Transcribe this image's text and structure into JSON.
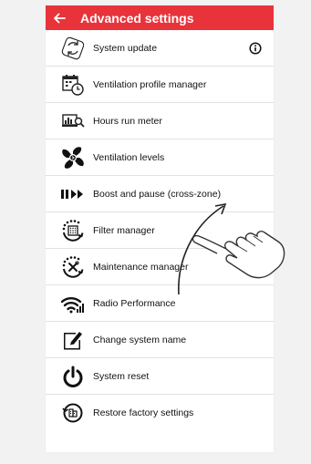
{
  "header": {
    "title": "Advanced settings"
  },
  "items": [
    {
      "label": "System update",
      "icon": "refresh-icon",
      "info_icon": "info-icon"
    },
    {
      "label": "Ventilation profile manager",
      "icon": "calendar-clock-icon"
    },
    {
      "label": "Hours run meter",
      "icon": "chart-magnifier-icon"
    },
    {
      "label": "Ventilation levels",
      "icon": "fan-icon"
    },
    {
      "label": "Boost and pause (cross-zone)",
      "icon": "pause-fast-forward-icon"
    },
    {
      "label": "Filter manager",
      "icon": "filter-icon"
    },
    {
      "label": "Maintenance manager",
      "icon": "tools-icon"
    },
    {
      "label": "Radio Performance",
      "icon": "wifi-signal-icon"
    },
    {
      "label": "Change system name",
      "icon": "edit-icon"
    },
    {
      "label": "System reset",
      "icon": "power-icon"
    },
    {
      "label": "Restore factory settings",
      "icon": "restore-icon"
    }
  ],
  "colors": {
    "accent": "#e8333b",
    "text": "#111111",
    "background": "#f2f2f2"
  },
  "gesture": {
    "icon": "swipe-up-hand-icon"
  }
}
